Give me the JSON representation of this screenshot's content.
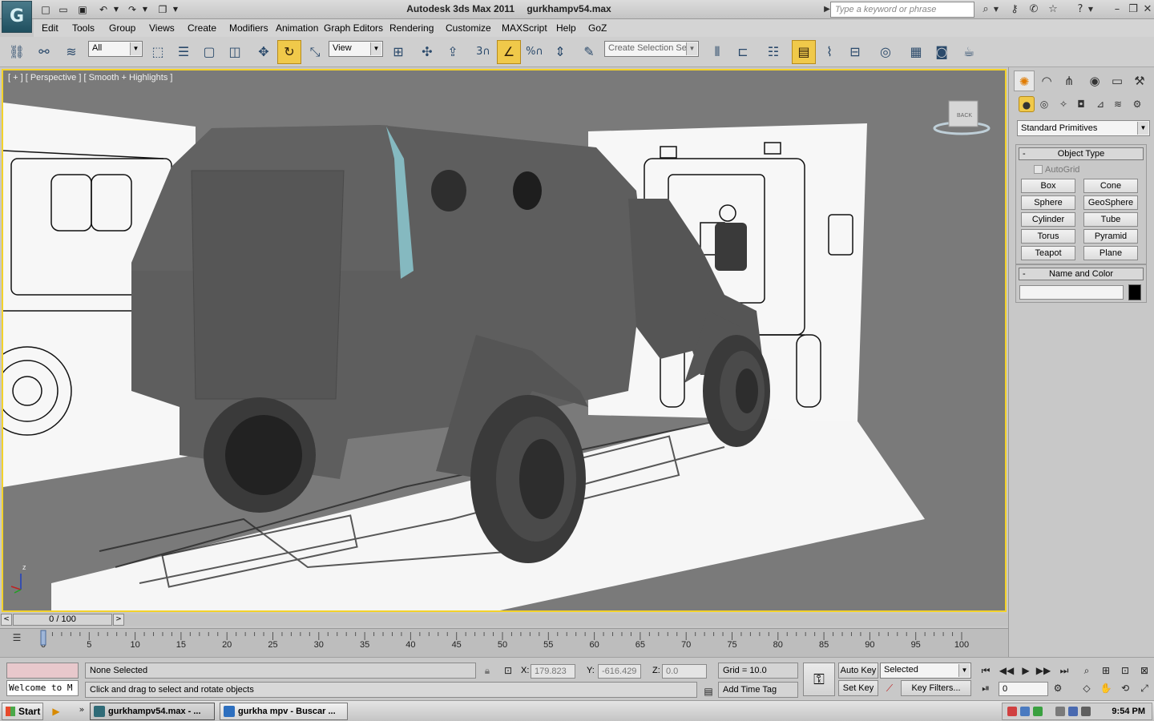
{
  "window": {
    "app_name": "Autodesk 3ds Max  2011",
    "file_name": "gurkhampv54.max",
    "logo_icon": "3dsmax-logo-icon",
    "search_placeholder": "Type a keyword or phrase"
  },
  "menu": [
    "Edit",
    "Tools",
    "Group",
    "Views",
    "Create",
    "Modifiers",
    "Animation",
    "Graph Editors",
    "Rendering",
    "Customize",
    "MAXScript",
    "Help",
    "GoZ"
  ],
  "toolbar": {
    "selection_filter": "All",
    "reference_coord": "View",
    "snap_label": "3",
    "named_selection_placeholder": "Create Selection Se"
  },
  "viewport": {
    "label": "[ + ] [ Perspective ] [ Smooth + Highlights ]",
    "viewcube_label": "BACK",
    "axis_z": "z",
    "axis_x": "x",
    "axis_y": "y"
  },
  "command_panel": {
    "category": "Standard Primitives",
    "object_type_title": "Object Type",
    "autogrid_label": "AutoGrid",
    "primitives": [
      "Box",
      "Cone",
      "Sphere",
      "GeoSphere",
      "Cylinder",
      "Tube",
      "Torus",
      "Pyramid",
      "Teapot",
      "Plane"
    ],
    "name_color_title": "Name and Color",
    "name_value": "",
    "swatch_color": "#000000"
  },
  "timeline": {
    "frame_display": "0 / 100",
    "ticks": [
      "0",
      "5",
      "10",
      "15",
      "20",
      "25",
      "30",
      "35",
      "40",
      "45",
      "50",
      "55",
      "60",
      "65",
      "70",
      "75",
      "80",
      "85",
      "90",
      "95",
      "100"
    ]
  },
  "status": {
    "maxscript_text": "Welcome to M",
    "selection": "None Selected",
    "prompt": "Click and drag to select and rotate objects",
    "x_label": "X:",
    "x_value": "179.823",
    "y_label": "Y:",
    "y_value": "-616.429",
    "z_label": "Z:",
    "z_value": "0.0",
    "grid": "Grid = 10.0",
    "add_time_tag": "Add Time Tag",
    "auto_key": "Auto Key",
    "set_key": "Set Key",
    "key_mode": "Selected",
    "key_filters": "Key Filters...",
    "current_frame": "0"
  },
  "taskbar": {
    "start": "Start",
    "tasks": [
      {
        "label": "gurkhampv54.max - ...",
        "active": true,
        "color": "#2f6b77"
      },
      {
        "label": "gurkha mpv - Buscar ...",
        "active": false,
        "color": "#2d6fbf"
      }
    ],
    "clock": "9:54 PM"
  },
  "colors": {
    "viewport_border": "#f3d22b",
    "active_tool": "#f0c94a",
    "viewport_bg": "#7a7a7a"
  }
}
